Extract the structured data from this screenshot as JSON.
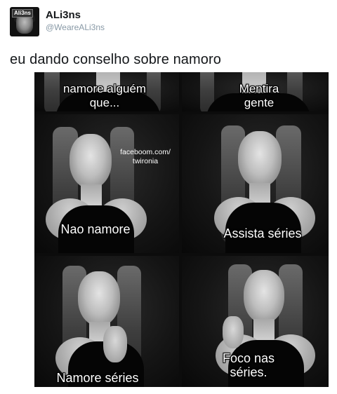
{
  "tweet": {
    "display_name": "ALi3ns",
    "handle": "@WeareALi3ns",
    "avatar_logo": "Ali3ns",
    "text": "eu dando conselho sobre namoro"
  },
  "meme": {
    "watermark": "faceboom.com/\ntwironia",
    "panels": [
      {
        "caption": "namore alguém\nque..."
      },
      {
        "caption": "Mentira\ngente"
      },
      {
        "caption": "Nao namore"
      },
      {
        "caption": "Assista séries"
      },
      {
        "caption": "Namore séries"
      },
      {
        "caption": "Foco nas\nséries."
      }
    ]
  }
}
